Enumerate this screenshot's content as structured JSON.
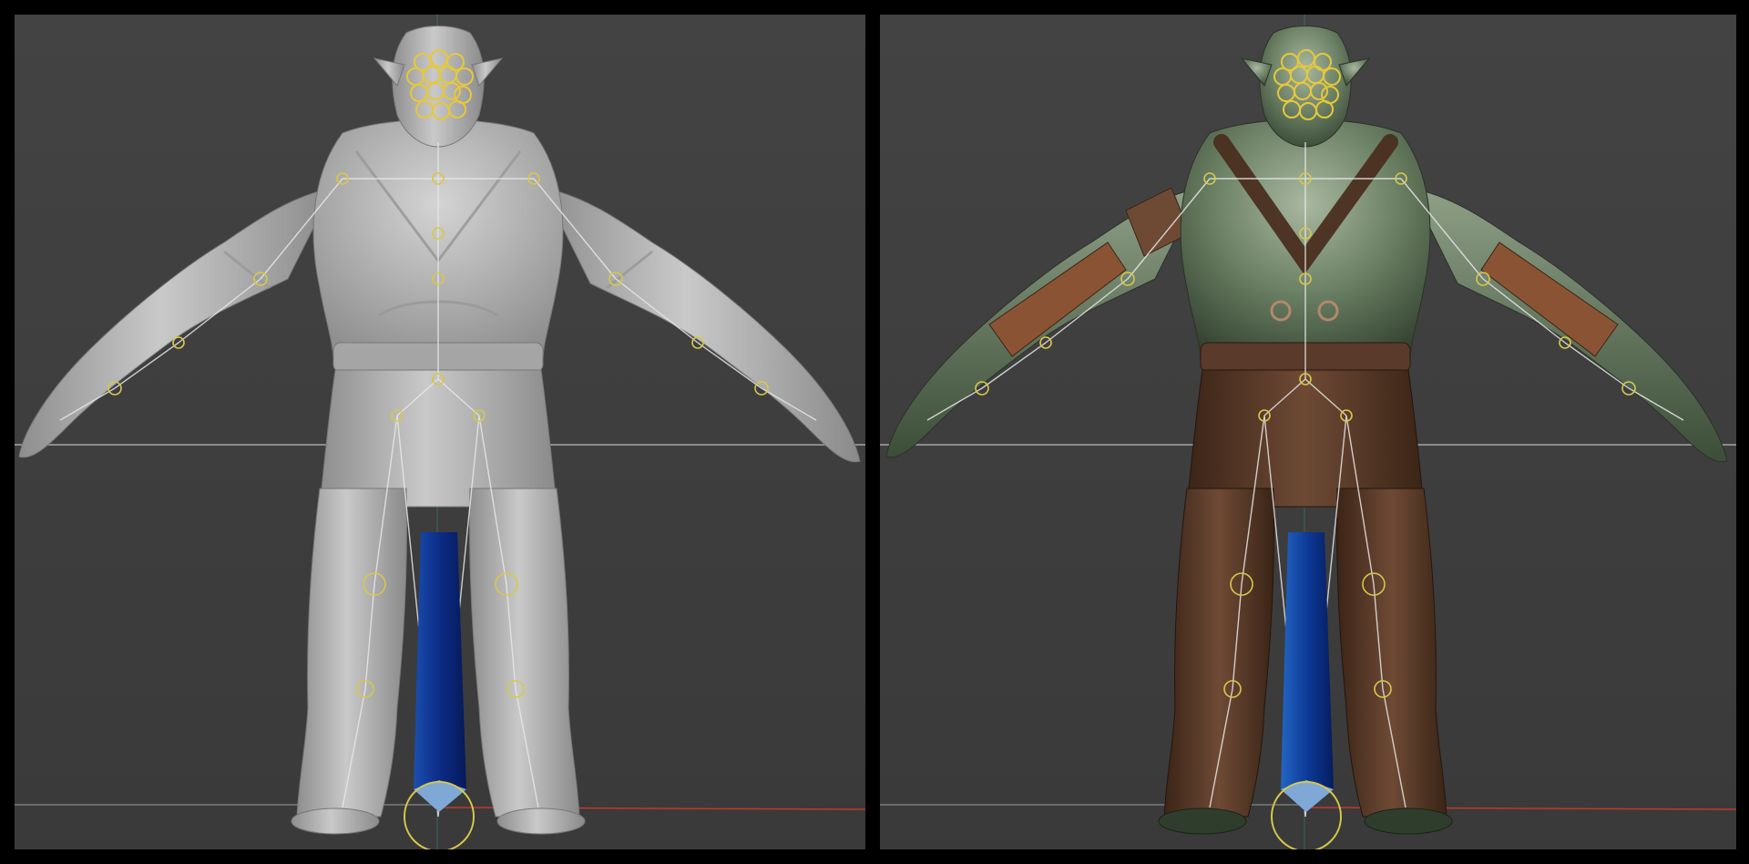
{
  "app": {
    "description_name": "3d-rig-comparison"
  },
  "viewports": [
    {
      "id": "left",
      "mode": "solid-shaded",
      "body_color": "#b9b9b9",
      "body_shadow": "#8e8e8e"
    },
    {
      "id": "right",
      "mode": "textured",
      "skin_color": "#5b6f55",
      "skin_highlight": "#a9b8a1",
      "leather_color": "#5a3a2a",
      "strap_color": "#4a2e1f"
    }
  ],
  "colors": {
    "viewport_bg": "#404040",
    "horizon_line": "#8c8c8c",
    "ground_axis_x": "#c0392b",
    "ground_axis_z": "#2e86c1",
    "bone": "#e8e8e8",
    "joint": "#d7c84a",
    "face_control": "#e6c83a",
    "root_blade_dark": "#0d2a7a",
    "root_blade_light": "#1e5fb8",
    "root_tip": "#7fa8d6"
  },
  "icons": [
    "root-control-icon",
    "face-controls-icon"
  ]
}
